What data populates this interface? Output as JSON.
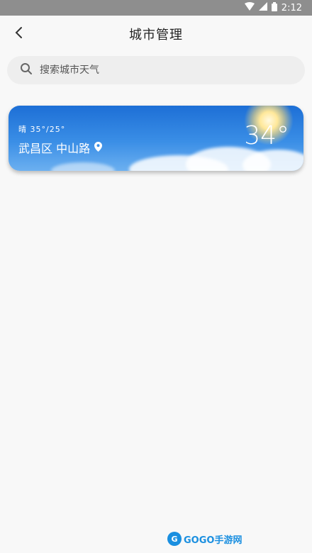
{
  "status_bar": {
    "time": "2:12",
    "icons": [
      "wifi-icon",
      "cellular-signal-icon",
      "battery-icon"
    ]
  },
  "header": {
    "title": "城市管理",
    "back_icon": "chevron-left-icon"
  },
  "search": {
    "placeholder": "搜索城市天气",
    "value": "",
    "icon": "search-icon"
  },
  "city_card": {
    "condition": "晴 35°/25°",
    "location": "武昌区 中山路",
    "location_icon": "map-pin-icon",
    "temperature": "34°"
  },
  "watermark": {
    "text": "GOGO手游网"
  },
  "colors": {
    "background": "#f8f8f8",
    "status_bar": "#8e8e8e",
    "search_bg": "#eeeeee",
    "card_sky": "#2a7fe0",
    "watermark": "#1a8fe0"
  }
}
